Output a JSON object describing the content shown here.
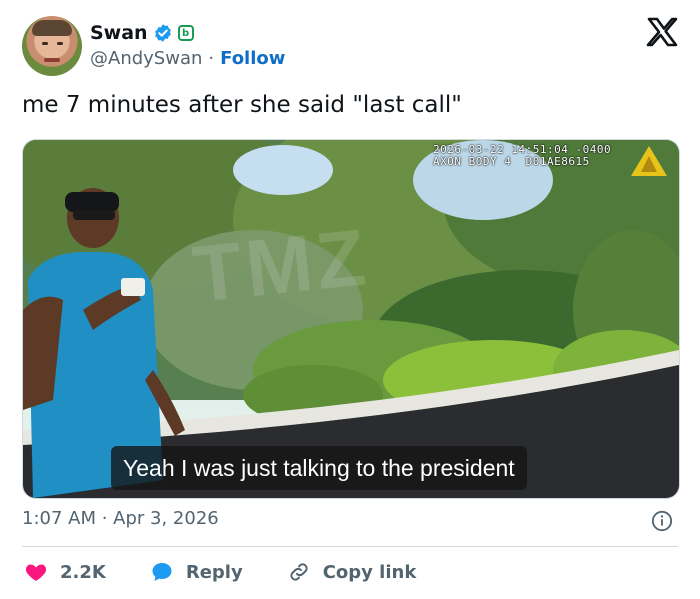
{
  "author": {
    "name": "Swan",
    "handle": "@AndySwan",
    "separator": "·",
    "follow_label": "Follow",
    "affiliate_badge": "b"
  },
  "tweet": {
    "text": "me 7 minutes after she said \"last call\"",
    "timestamp": "1:07 AM · Apr 3, 2026"
  },
  "media": {
    "bodycam_line1": "2026-03-22 14:51:04 -0400",
    "bodycam_line2": "AXON BODY 4  D01AE8615",
    "watermark": "TMZ",
    "caption": "Yeah I was just talking to the president"
  },
  "actions": {
    "like_count": "2.2K",
    "reply_label": "Reply",
    "copy_link_label": "Copy link"
  },
  "colors": {
    "like": "#f91880",
    "reply": "#1d9bf0",
    "follow": "#0f6fc6",
    "verified": "#1d9bf0",
    "affiliate": "#1a9b53"
  },
  "icons": [
    "verified-badge-icon",
    "affiliate-badge-icon",
    "x-logo-icon",
    "info-icon",
    "heart-icon",
    "reply-bubble-icon",
    "link-icon"
  ]
}
